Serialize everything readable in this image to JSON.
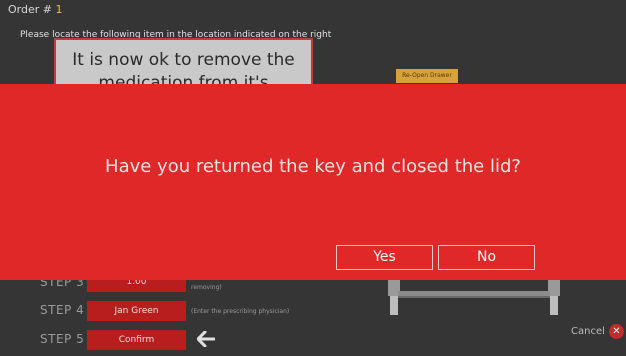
{
  "header": {
    "order_label": "Order #",
    "order_number": "1"
  },
  "instructions": "Please locate the following item in the location indicated on the right",
  "notice": "It is now ok to remove the medication from it's packaging",
  "reopen_drawer_label": "Re-Open Drawer",
  "steps": [
    {
      "label": "STEP 3",
      "value": "1.00",
      "hint": "removing)"
    },
    {
      "label": "STEP 4",
      "value": "Jan Green",
      "hint": "(Enter the prescribing physician)"
    },
    {
      "label": "STEP 5",
      "value": "Confirm",
      "hint": ""
    }
  ],
  "back_icon": "left-arrow-icon",
  "cancel": {
    "label": "Cancel",
    "icon": "close-icon",
    "icon_glyph": "✕"
  },
  "dialog": {
    "question": "Have you returned the key and closed the lid?",
    "yes_label": "Yes",
    "no_label": "No"
  },
  "colors": {
    "background": "#353535",
    "dialog_red": "#e02829",
    "button_red": "#b81e1e",
    "drawer_button": "#d8a23a",
    "order_number": "#e8c23a"
  }
}
